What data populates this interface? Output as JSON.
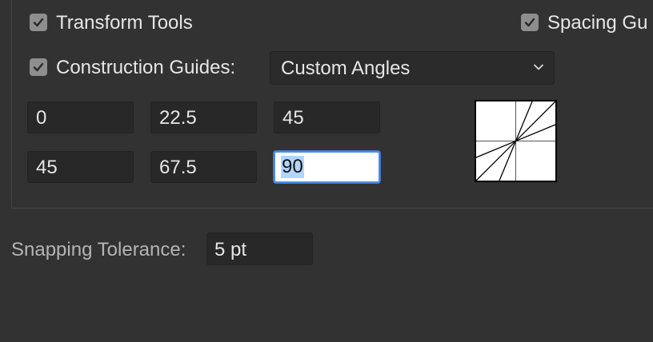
{
  "transform_tools": {
    "label": "Transform Tools",
    "checked": true
  },
  "spacing_guides": {
    "label": "Spacing Gu",
    "checked": true
  },
  "construction_guides": {
    "label": "Construction Guides:",
    "checked": true,
    "selected": "Custom Angles"
  },
  "angles": {
    "row1": [
      "0",
      "22.5",
      "45"
    ],
    "row2": [
      "45",
      "67.5",
      "90"
    ]
  },
  "snapping_tolerance": {
    "label": "Snapping Tolerance:",
    "value": "5 pt"
  },
  "colors": {
    "background": "#323232",
    "field": "#282828",
    "focus_ring": "#4b8fe2",
    "selection": "#b3d5fd"
  }
}
